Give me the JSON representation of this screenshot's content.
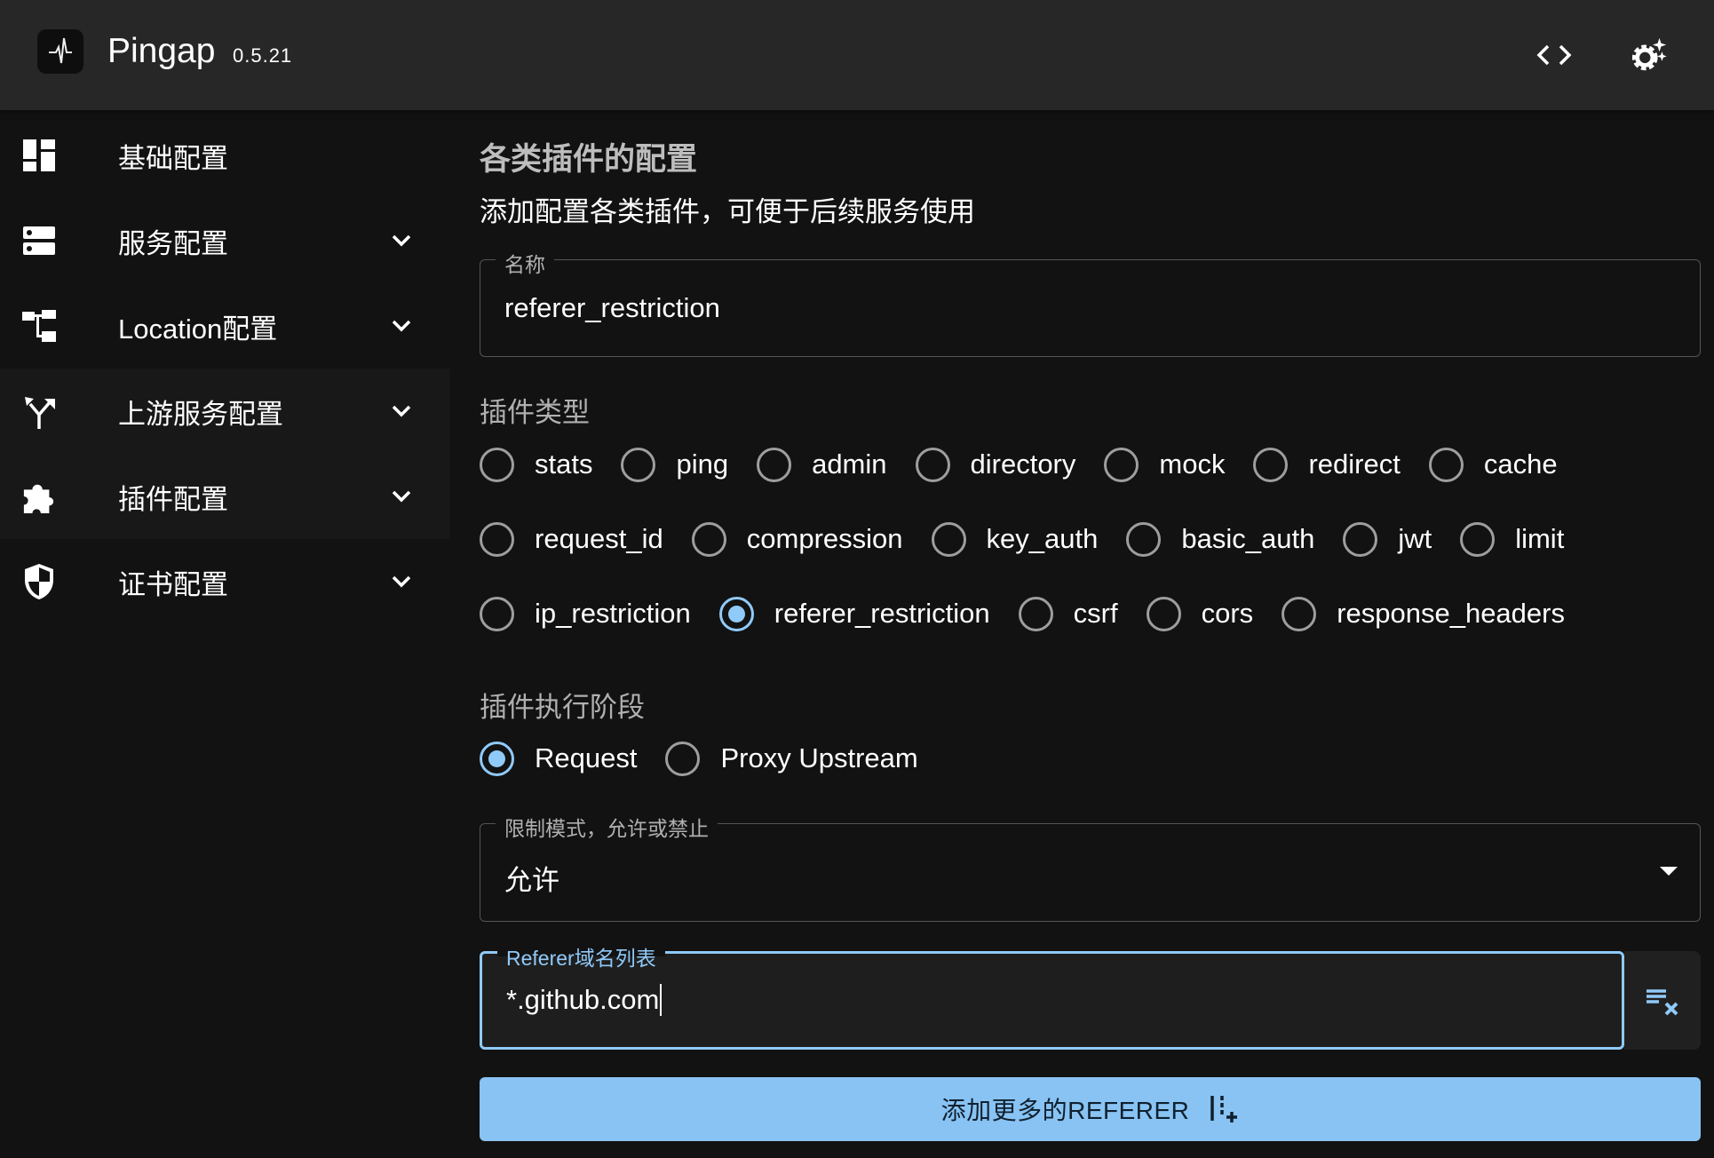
{
  "header": {
    "title": "Pingap",
    "version": "0.5.21",
    "icons": [
      "pulse-logo-icon",
      "code-icon",
      "settings-sparkle-icon"
    ]
  },
  "sidebar": {
    "items": [
      {
        "label": "基础配置",
        "icon": "dashboard-icon",
        "expandable": false
      },
      {
        "label": "服务配置",
        "icon": "dns-icon",
        "expandable": true
      },
      {
        "label": "Location配置",
        "icon": "account-tree-icon",
        "expandable": true
      },
      {
        "label": "上游服务配置",
        "icon": "fork-icon",
        "expandable": true
      },
      {
        "label": "插件配置",
        "icon": "extension-icon",
        "expandable": true
      },
      {
        "label": "证书配置",
        "icon": "shield-icon",
        "expandable": true
      }
    ]
  },
  "main": {
    "title": "各类插件的配置",
    "subtitle": "添加配置各类插件，可便于后续服务使用",
    "name_field": {
      "label": "名称",
      "value": "referer_restriction"
    },
    "plugin_type": {
      "label": "插件类型",
      "selected": "referer_restriction",
      "rows": [
        [
          "stats",
          "ping",
          "admin",
          "directory",
          "mock",
          "redirect",
          "cache"
        ],
        [
          "request_id",
          "compression",
          "key_auth",
          "basic_auth",
          "jwt",
          "limit"
        ],
        [
          "ip_restriction",
          "referer_restriction",
          "csrf",
          "cors",
          "response_headers"
        ]
      ]
    },
    "step": {
      "label": "插件执行阶段",
      "selected": "Request",
      "options": [
        "Request",
        "Proxy Upstream"
      ]
    },
    "mode_field": {
      "label": "限制模式，允许或禁止",
      "value": "允许"
    },
    "referer_field": {
      "label": "Referer域名列表",
      "value": "*.github.com"
    },
    "add_button": "添加更多的REFERER",
    "accent": "#90caf9"
  }
}
